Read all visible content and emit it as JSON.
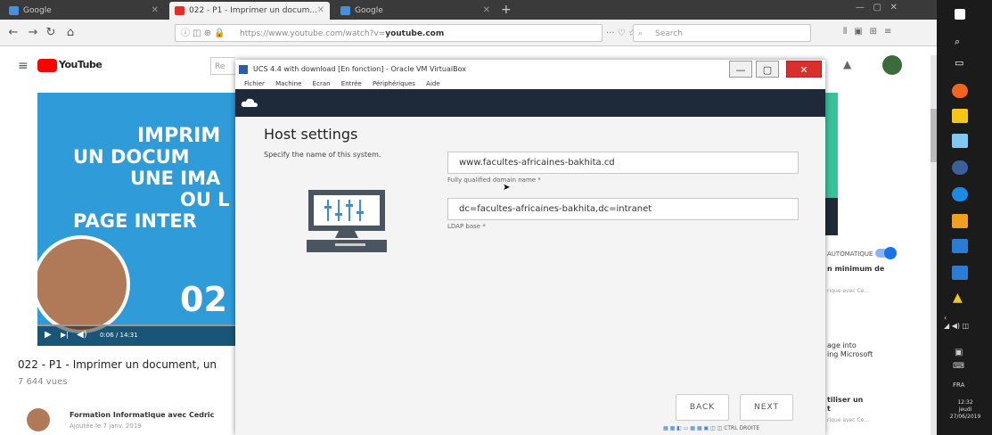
{
  "browser": {
    "tabs": [
      {
        "label": "Google",
        "active": false
      },
      {
        "label": "022 - P1 - Imprimer un docum...",
        "active": true
      },
      {
        "label": "Google",
        "active": false
      }
    ],
    "url_domain": "youtube.com",
    "url_text": "https://www.youtube.com/watch?v=",
    "search_placeholder": "Search"
  },
  "youtube": {
    "logo_text": "YouTube",
    "video_title_lines": [
      "IMPRIM",
      "UN DOCUM",
      "UNE IMA",
      "OU L",
      "PAGE INTER"
    ],
    "episode": "02",
    "time": "0:06 / 14:31",
    "title": "022 - P1 - Imprimer un document, un",
    "views": "7 644 vues",
    "channel": "Formation Informatique avec Cedric",
    "published": "Ajoutée le 7 janv. 2019",
    "right": {
      "autoplay": "AUTOMATIQUE",
      "item1": "n minimum de",
      "item1_sub": "rique avec Ce...",
      "item2_a": "age into",
      "item2_b": "ing Microsoft",
      "item3_a": "tiliser un",
      "item3_b": "t",
      "item3_sub": "rique avec Ce..."
    }
  },
  "vm": {
    "window_title": "UCS 4.4 with download [En fonction] - Oracle VM VirtualBox",
    "menu": [
      "Fichier",
      "Machine",
      "Écran",
      "Entrée",
      "Périphériques",
      "Aide"
    ],
    "heading": "Host settings",
    "description": "Specify the name of this system.",
    "fqdn_value": "www.facultes-africaines-bakhita.cd",
    "fqdn_label": "Fully qualified domain name *",
    "ldap_value": "dc=facultes-africaines-bakhita,dc=intranet",
    "ldap_label": "LDAP base *",
    "back": "BACK",
    "next": "NEXT",
    "status_right": "CTRL DROITE"
  },
  "taskbar": {
    "lang": "FRA",
    "time": "12:32",
    "day": "jeudi",
    "date": "27/06/2019"
  },
  "colors": {
    "youtube_red": "#ff0000",
    "vm_titlebar_dark": "#1e2a3a",
    "video_blue": "#2f9bd8",
    "close_red": "#d9302c"
  }
}
